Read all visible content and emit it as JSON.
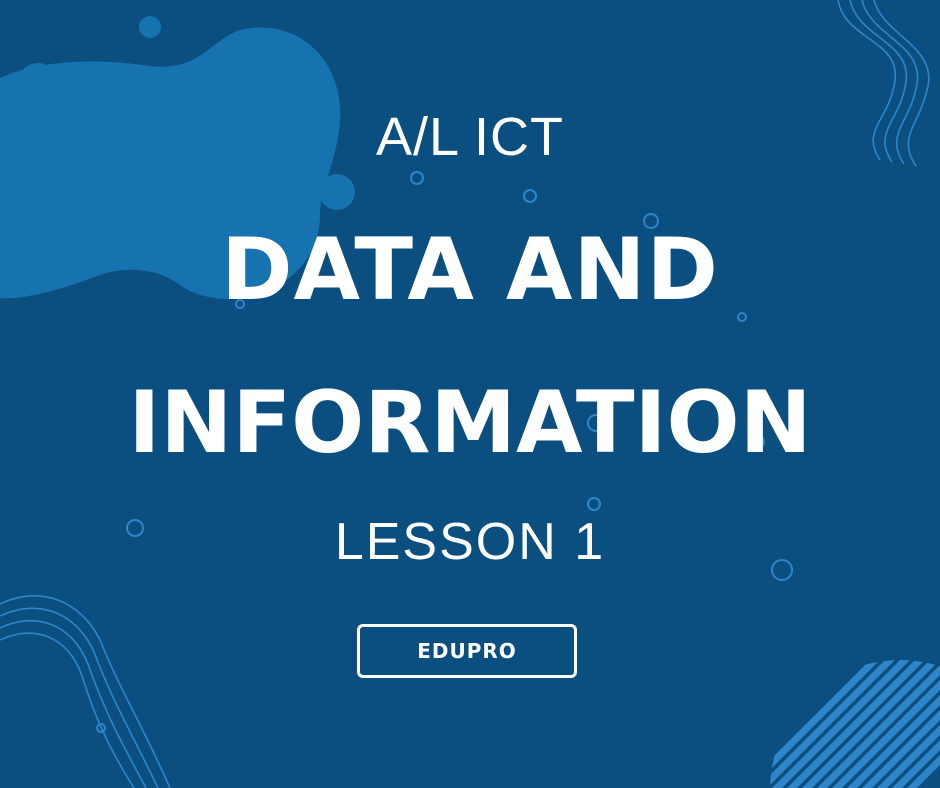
{
  "poster": {
    "kicker": "A/L ICT",
    "title_line1": "DATA AND",
    "title_line2": "INFORMATION",
    "subtitle": "LESSON 1",
    "badge": "EDUPRO"
  },
  "colors": {
    "background": "#0a4f80",
    "blob": "#1673b0",
    "accent_line": "#2e86c8",
    "text": "#ffffff"
  }
}
